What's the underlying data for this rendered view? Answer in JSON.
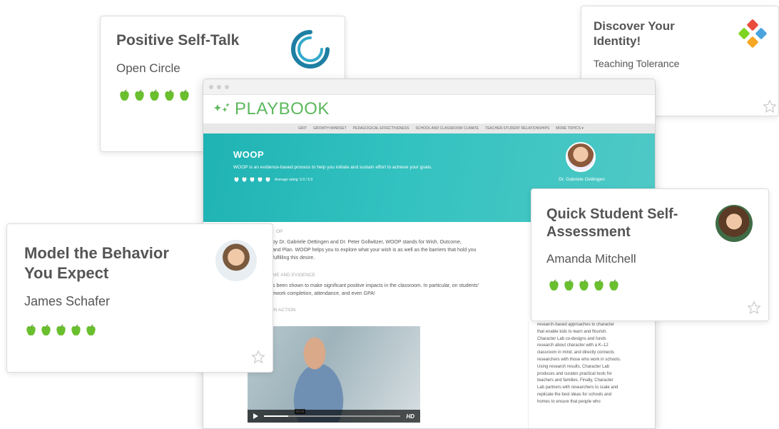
{
  "cards": {
    "positive_self_talk": {
      "title": "Positive Self-Talk",
      "author": "Open Circle",
      "rating": 5
    },
    "discover_identity": {
      "title_line1": "Discover Your",
      "title_line2": "Identity!",
      "author": "Teaching Tolerance"
    },
    "quick_assessment": {
      "title_line1": "Quick Student Self-",
      "title_line2": "Assessment",
      "author": "Amanda Mitchell",
      "rating": 5
    },
    "model_behavior": {
      "title_line1": "Model the Behavior",
      "title_line2": "You Expect",
      "author": "James Schafer",
      "rating": 5
    }
  },
  "browser": {
    "logo": "PLAYBOOK",
    "nav": [
      "GRIT",
      "GROWTH MINDSET",
      "PEDAGOGICAL EFFECTIVENESS",
      "SCHOOL AND CLASSROOM CLIMATE",
      "TEACHER-STUDENT RELATIONSHIPS",
      "MORE TOPICS ▾"
    ],
    "hero": {
      "title": "WOOP",
      "description": "WOOP is an evidence-based process to help you initiate and sustain effort to achieve your goals.",
      "rating_text": "Average rating: 5.0 / 5.0",
      "author": "Dr. Gabriele Oettingen"
    },
    "content": {
      "heading1": "OP",
      "para1_line1": "by Dr. Gabriele Oettingen and Dr. Peter Gollwitzer, WOOP stands for Wish, Outcome,",
      "para1_line2": "and Plan. WOOP helps you to explore what your wish is as well as the barriers that hold you",
      "para1_line3": "fulfilling this desire.",
      "heading2": "ME AND EVIDENCE",
      "para2_line1": "s been shown to make significant positive impacts in the classroom. In particular, on students'",
      "para2_line2": "ework completion, attendance, and even GPA!",
      "heading3": "IN ACTION",
      "video_time": "00:36",
      "video_hd": "HD"
    },
    "sidebar_text": "research-based approaches to character that enable kids to learn and flourish. Character Lab co-designs and funds research about character with a K–12 classroom in mind, and directly connects researchers with those who work in schools. Using research results, Character Lab produces and curates practical tools for teachers and families. Finally, Character Lab partners with researchers to scale and replicate the best ideas for schools and homes to ensure that people who"
  },
  "colors": {
    "green": "#6abf2e",
    "teal": "#2dbdbb",
    "logo_green": "#5cb85c"
  }
}
